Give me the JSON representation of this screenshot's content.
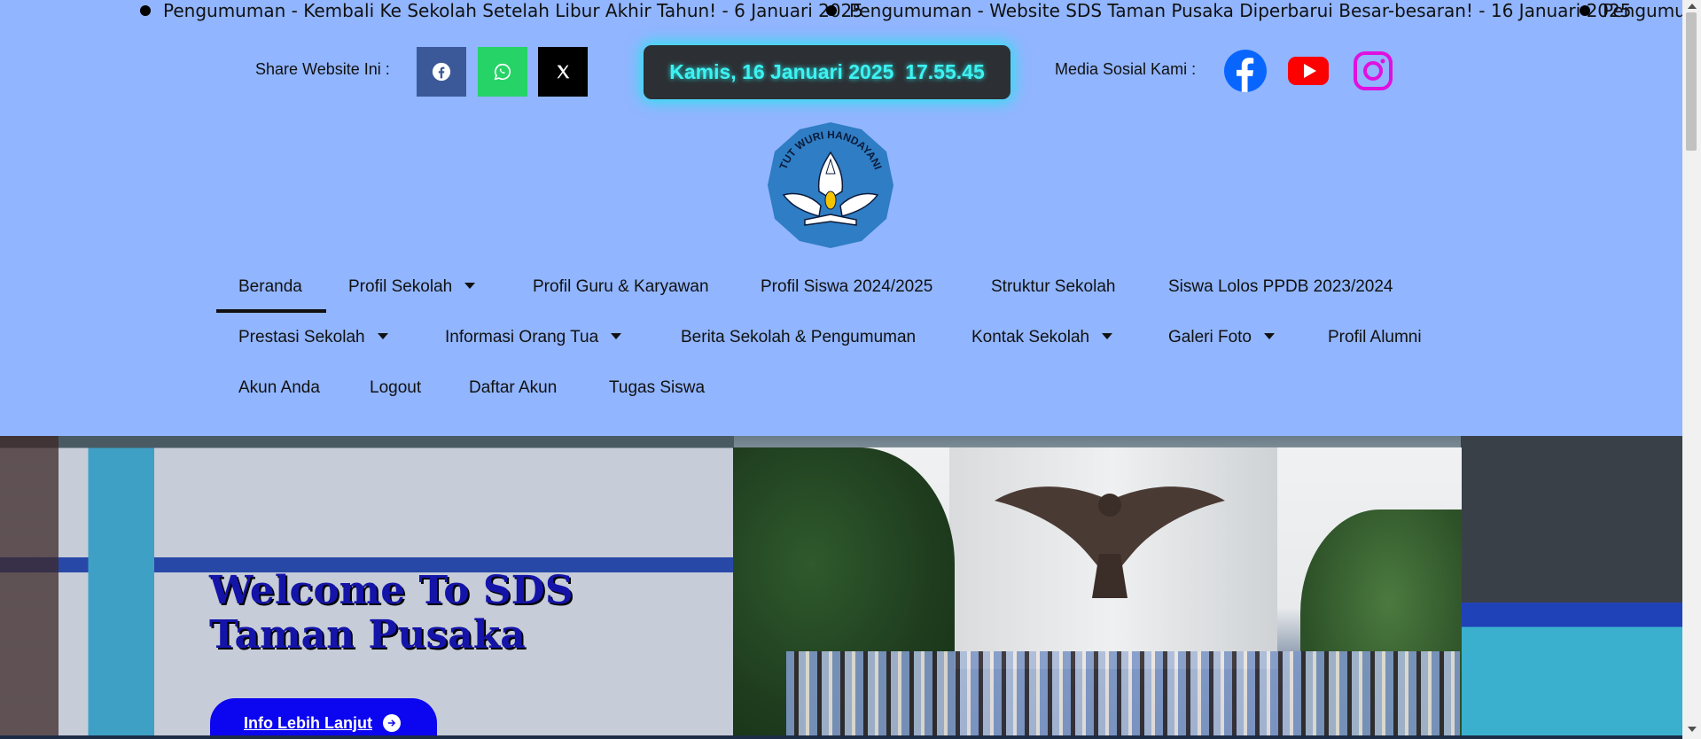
{
  "ticker": {
    "items": [
      "Pengumuman - Kembali Ke Sekolah Setelah Libur Akhir Tahun! - 6 Januari 2025",
      "Pengumuman - Website SDS Taman Pusaka Diperbarui Besar-besaran! - 16 Januari 2025",
      "Pengumu"
    ]
  },
  "share": {
    "label": "Share Website Ini :",
    "buttons": [
      {
        "name": "facebook",
        "icon": "facebook-icon",
        "color": "#3b5998"
      },
      {
        "name": "whatsapp",
        "icon": "whatsapp-icon",
        "color": "#25d366"
      },
      {
        "name": "x",
        "icon": "x-icon",
        "color": "#000000"
      }
    ]
  },
  "clock": {
    "text": "Kamis, 16 Januari 2025  17.55.45",
    "text_color": "#3ef2f2",
    "bg_color": "#2c2f33"
  },
  "social": {
    "label": "Media Sosial Kami :",
    "links": [
      {
        "name": "facebook",
        "icon": "facebook-icon",
        "color": "#0866ff"
      },
      {
        "name": "youtube",
        "icon": "youtube-icon",
        "color": "#ff0000"
      },
      {
        "name": "instagram",
        "icon": "instagram-icon",
        "color": "#e010e0"
      }
    ]
  },
  "logo": {
    "text": "TUT WURI HANDAYANI",
    "icon": "tut-wuri-handayani-logo"
  },
  "nav": {
    "items": [
      {
        "label": "Beranda",
        "dropdown": false,
        "active": true
      },
      {
        "label": "Profil Sekolah",
        "dropdown": true
      },
      {
        "label": "Profil Guru & Karyawan",
        "dropdown": false
      },
      {
        "label": "Profil Siswa 2024/2025",
        "dropdown": false
      },
      {
        "label": "Struktur Sekolah",
        "dropdown": false
      },
      {
        "label": "Siswa Lolos PPDB 2023/2024",
        "dropdown": false
      },
      {
        "label": "Prestasi Sekolah",
        "dropdown": true
      },
      {
        "label": "Informasi Orang Tua",
        "dropdown": true
      },
      {
        "label": "Berita Sekolah & Pengumuman",
        "dropdown": false
      },
      {
        "label": "Kontak Sekolah",
        "dropdown": true
      },
      {
        "label": "Galeri Foto",
        "dropdown": true
      },
      {
        "label": "Profil Alumni",
        "dropdown": false
      },
      {
        "label": "Akun Anda",
        "dropdown": false
      },
      {
        "label": "Logout",
        "dropdown": false
      },
      {
        "label": "Daftar Akun",
        "dropdown": false
      },
      {
        "label": "Tugas Siswa",
        "dropdown": false
      }
    ]
  },
  "hero": {
    "title": "Welcome To SDS Taman Pusaka",
    "button_label": "Info Lebih Lanjut",
    "button_icon": "arrow-right-circle-icon",
    "title_color": "#1414a8",
    "button_color": "#0c05f0"
  },
  "colors": {
    "page_bg": "#91b5fe",
    "clock_glow": "#25e4f0"
  }
}
